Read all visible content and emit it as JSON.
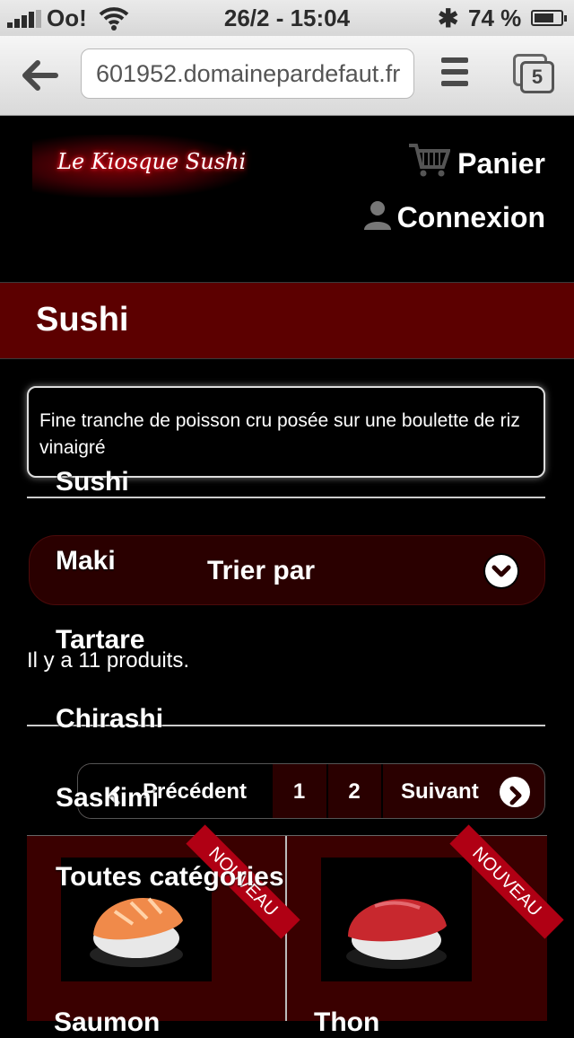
{
  "status_bar": {
    "carrier": "Oo!",
    "datetime": "26/2 - 15:04",
    "battery_text": "74 %",
    "battery_level": 0.74
  },
  "browser": {
    "url": "601952.domainepardefaut.fr",
    "tab_count": "5"
  },
  "site": {
    "logo_text": "Le Kiosque Sushi",
    "cart_label": "Panier",
    "login_label": "Connexion"
  },
  "category": {
    "title": "Sushi",
    "description": "Fine tranche de poisson cru posée sur une boulette de riz vinaigré"
  },
  "sort": {
    "label": "Trier par"
  },
  "product_count": "Il y a 11 produits.",
  "pagination": {
    "prev_label": "Précédent",
    "pages": [
      "1",
      "2"
    ],
    "next_label": "Suivant"
  },
  "category_menu": {
    "items": [
      "Sushi",
      "Maki",
      "Tartare",
      "Chirashi",
      "Sashimi",
      "Toutes catégories"
    ]
  },
  "products": [
    {
      "badge": "NOUVEAU",
      "name": "Saumon",
      "colors": {
        "fish": "#f08a4a"
      }
    },
    {
      "badge": "NOUVEAU",
      "name": "Thon",
      "colors": {
        "fish": "#c8282e"
      }
    }
  ],
  "colors": {
    "banner": "#5c0000",
    "accent_dark": "#2a0000",
    "ribbon": "#b00014"
  }
}
